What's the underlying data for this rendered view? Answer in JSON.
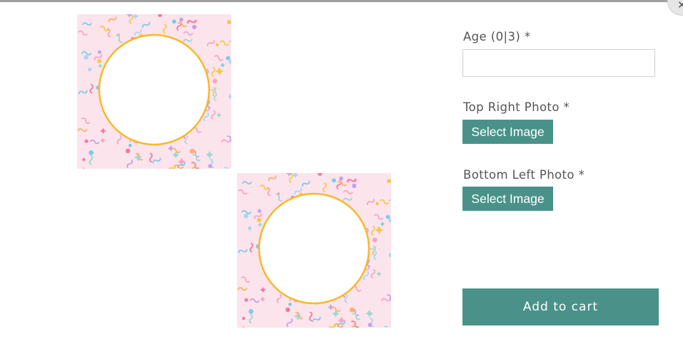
{
  "modal": {
    "close_icon": "close-icon",
    "close_glyph": "✕"
  },
  "preview": {
    "frame_pattern": "confetti",
    "frame_background": "#fce4ec",
    "circle_border_color": "#f7b928"
  },
  "form": {
    "age_label": "Age (0|3) *",
    "age_value": "",
    "top_right_photo_label": "Top Right Photo *",
    "top_right_button": "Select Image",
    "bottom_left_photo_label": "Bottom Left Photo *",
    "bottom_left_button": "Select Image",
    "add_to_cart_label": "Add to cart"
  },
  "colors": {
    "accent": "#4a9289",
    "label_text": "#555555",
    "border": "#cfcfcf"
  }
}
